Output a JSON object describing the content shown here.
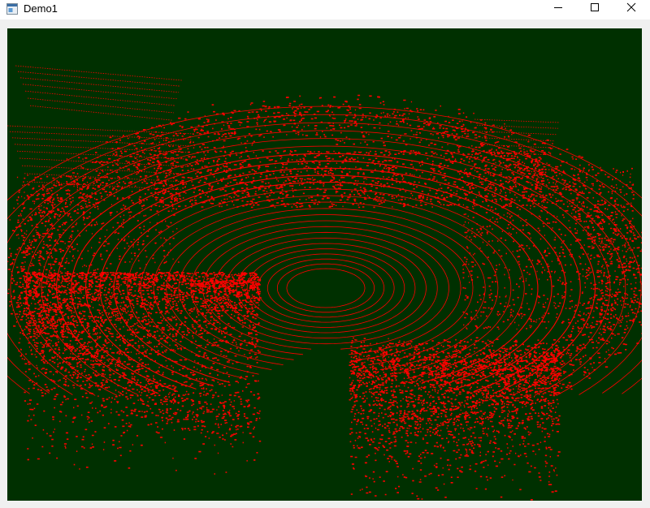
{
  "window": {
    "title": "Demo1",
    "icon": "app-window-icon"
  },
  "controls": {
    "minimize_icon": "minimize-icon",
    "maximize_icon": "maximize-icon",
    "close_icon": "close-icon"
  },
  "view": {
    "content": "point-cloud-render",
    "background_color": "#003000",
    "point_color": "#ff0000"
  }
}
